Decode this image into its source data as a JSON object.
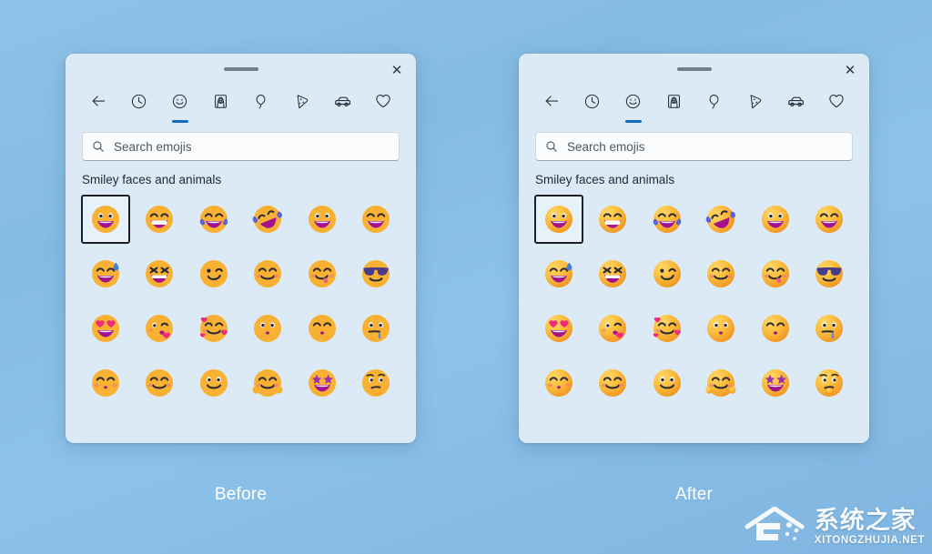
{
  "background": {
    "gradient_from": "#8fc2e8",
    "gradient_to": "#7fb5e0"
  },
  "accent_color": "#0f6cbd",
  "panels": [
    {
      "id": "before",
      "caption": "Before",
      "style": "flat",
      "titlebar": {
        "drag_handle": "drag-handle",
        "close_label": "✕"
      },
      "tabs": [
        {
          "name": "back",
          "label": "Back",
          "active": false
        },
        {
          "name": "recent",
          "label": "Recently used",
          "active": false
        },
        {
          "name": "smileys",
          "label": "Smiley faces and animals",
          "active": true
        },
        {
          "name": "people",
          "label": "People",
          "active": false
        },
        {
          "name": "celebration",
          "label": "Celebration and objects",
          "active": false
        },
        {
          "name": "food",
          "label": "Food and plants",
          "active": false
        },
        {
          "name": "transport",
          "label": "Transport and places",
          "active": false
        },
        {
          "name": "symbols",
          "label": "Symbols",
          "active": false
        }
      ],
      "search": {
        "placeholder": "Search emojis",
        "value": "",
        "icon": "search-icon"
      },
      "section_title": "Smiley faces and animals",
      "grid": [
        {
          "name": "grinning-face-big-eyes",
          "selected": true
        },
        {
          "name": "beaming-face-smiling-eyes",
          "selected": false
        },
        {
          "name": "face-with-tears-of-joy",
          "selected": false
        },
        {
          "name": "rolling-on-the-floor-laughing",
          "selected": false
        },
        {
          "name": "grinning-face",
          "selected": false
        },
        {
          "name": "grinning-face-smiling-eyes",
          "selected": false
        },
        {
          "name": "grinning-face-with-sweat",
          "selected": false
        },
        {
          "name": "squinting-face-with-tongue",
          "selected": false
        },
        {
          "name": "winking-face",
          "selected": false
        },
        {
          "name": "smiling-face-with-smiling-eyes",
          "selected": false
        },
        {
          "name": "face-savoring-food",
          "selected": false
        },
        {
          "name": "smiling-face-with-sunglasses",
          "selected": false
        },
        {
          "name": "smiling-face-with-heart-eyes",
          "selected": false
        },
        {
          "name": "face-blowing-a-kiss",
          "selected": false
        },
        {
          "name": "smiling-face-with-hearts",
          "selected": false
        },
        {
          "name": "kissing-face",
          "selected": false
        },
        {
          "name": "kissing-face-with-closed-eyes",
          "selected": false
        },
        {
          "name": "drooling-face",
          "selected": false
        },
        {
          "name": "kissing-face-with-smiling-eyes",
          "selected": false
        },
        {
          "name": "slightly-smiling-face",
          "selected": false
        },
        {
          "name": "neutral-smiling-face",
          "selected": false
        },
        {
          "name": "smiling-face-with-open-hands",
          "selected": false
        },
        {
          "name": "star-struck",
          "selected": false
        },
        {
          "name": "thinking-face",
          "selected": false
        }
      ]
    },
    {
      "id": "after",
      "caption": "After",
      "style": "gradient",
      "titlebar": {
        "drag_handle": "drag-handle",
        "close_label": "✕"
      },
      "tabs": [
        {
          "name": "back",
          "label": "Back",
          "active": false
        },
        {
          "name": "recent",
          "label": "Recently used",
          "active": false
        },
        {
          "name": "smileys",
          "label": "Smiley faces and animals",
          "active": true
        },
        {
          "name": "people",
          "label": "People",
          "active": false
        },
        {
          "name": "celebration",
          "label": "Celebration and objects",
          "active": false
        },
        {
          "name": "food",
          "label": "Food and plants",
          "active": false
        },
        {
          "name": "transport",
          "label": "Transport and places",
          "active": false
        },
        {
          "name": "symbols",
          "label": "Symbols",
          "active": false
        }
      ],
      "search": {
        "placeholder": "Search emojis",
        "value": "",
        "icon": "search-icon"
      },
      "section_title": "Smiley faces and animals",
      "grid": [
        {
          "name": "grinning-face-big-eyes",
          "selected": true
        },
        {
          "name": "beaming-face-smiling-eyes",
          "selected": false
        },
        {
          "name": "face-with-tears-of-joy",
          "selected": false
        },
        {
          "name": "rolling-on-the-floor-laughing",
          "selected": false
        },
        {
          "name": "grinning-face",
          "selected": false
        },
        {
          "name": "grinning-face-smiling-eyes",
          "selected": false
        },
        {
          "name": "grinning-face-with-sweat",
          "selected": false
        },
        {
          "name": "squinting-face-with-tongue",
          "selected": false
        },
        {
          "name": "winking-face",
          "selected": false
        },
        {
          "name": "smiling-face-with-smiling-eyes",
          "selected": false
        },
        {
          "name": "face-savoring-food",
          "selected": false
        },
        {
          "name": "smiling-face-with-sunglasses",
          "selected": false
        },
        {
          "name": "smiling-face-with-heart-eyes",
          "selected": false
        },
        {
          "name": "face-blowing-a-kiss",
          "selected": false
        },
        {
          "name": "smiling-face-with-hearts",
          "selected": false
        },
        {
          "name": "kissing-face",
          "selected": false
        },
        {
          "name": "kissing-face-with-closed-eyes",
          "selected": false
        },
        {
          "name": "drooling-face",
          "selected": false
        },
        {
          "name": "kissing-face-with-smiling-eyes",
          "selected": false
        },
        {
          "name": "slightly-smiling-face",
          "selected": false
        },
        {
          "name": "neutral-smiling-face",
          "selected": false
        },
        {
          "name": "smiling-face-with-open-hands",
          "selected": false
        },
        {
          "name": "star-struck",
          "selected": false
        },
        {
          "name": "thinking-face",
          "selected": false
        }
      ]
    }
  ],
  "watermark": {
    "cn": "系统之家",
    "en": "XITONGZHUJIA.NET",
    "logo": "house-logo-icon"
  }
}
